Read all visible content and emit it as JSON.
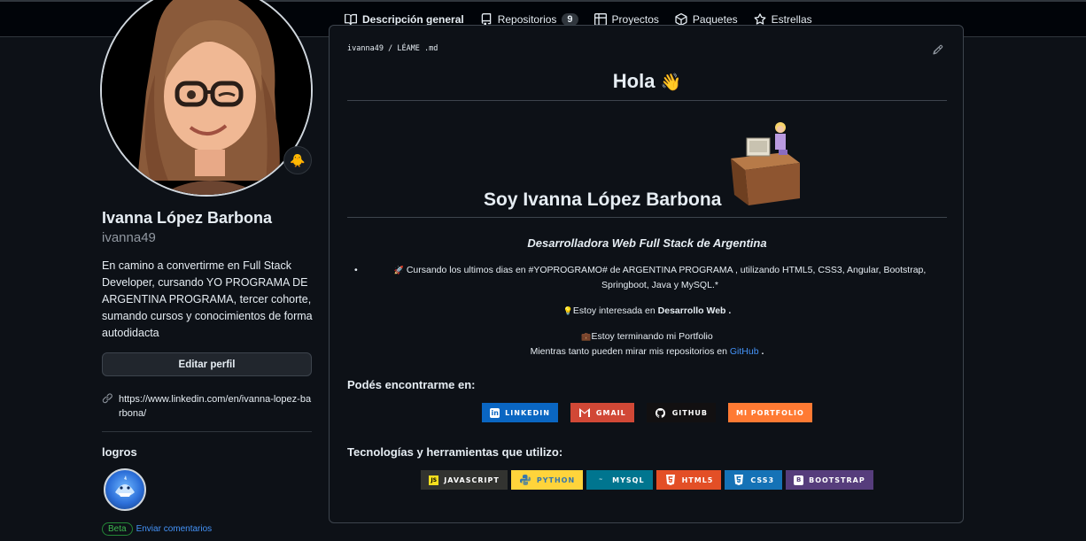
{
  "tabs": [
    {
      "label": "Descripción general",
      "icon": "book-icon",
      "active": true
    },
    {
      "label": "Repositorios",
      "icon": "repo-icon",
      "count": "9"
    },
    {
      "label": "Proyectos",
      "icon": "table-icon"
    },
    {
      "label": "Paquetes",
      "icon": "package-icon"
    },
    {
      "label": "Estrellas",
      "icon": "star-icon"
    }
  ],
  "profile": {
    "name": "Ivanna López Barbona",
    "login": "ivanna49",
    "bio": "En camino a convertirme en Full Stack Developer, cursando YO PROGRAMA DE ARGENTINA PROGRAMA, tercer cohorte, sumando cursos y conocimientos de forma autodidacta",
    "edit_label": "Editar perfil",
    "link": "https://www.linkedin.com/en/ivanna-lopez-barbona/",
    "status_emoji": "🐥",
    "achievements_title": "logros",
    "beta_label": "Beta",
    "feedback_label": "Enviar comentarios"
  },
  "readme": {
    "path_user": "ivanna49",
    "path_sep": "/",
    "path_file": "LÉAME .md",
    "title": "Hola",
    "wave": "👋",
    "heading": "Soy Ivanna López Barbona",
    "subtitle": "Desarrolladora Web Full Stack de Argentina",
    "bullet_emoji": "🚀",
    "bullet_text": "Cursando los ultimos dias en #YOPROGRAMO# de ARGENTINA PROGRAMA , utilizando HTML5, CSS3, Angular, Bootstrap, Springboot, Java y MySQL.*",
    "interest_emoji": "💡",
    "interest_prefix": "Estoy interesada en",
    "interest_bold": "Desarrollo Web",
    "interest_suffix": ".",
    "portfolio_emoji": "💼",
    "portfolio_text": "Estoy terminando mi Portfolio",
    "repos_prefix": "Mientras tanto pueden mirar mis repositorios en",
    "repos_link": "GitHub",
    "repos_suffix": ".",
    "find_title": "Podés encontrarme en:",
    "tech_title": "Tecnologías y herramientas que utilizo:"
  },
  "contact_badges": [
    {
      "label": "LINKEDIN",
      "color": "#0a66c2",
      "icon": "linkedin-icon"
    },
    {
      "label": "GMAIL",
      "color": "#d14836",
      "icon": "gmail-icon"
    },
    {
      "label": "GITHUB",
      "color": "#121011",
      "icon": "github-icon"
    },
    {
      "label": "MI PORTFOLIO",
      "color": "#ff7a33",
      "icon": ""
    }
  ],
  "tech_badges": [
    {
      "label": "JAVASCRIPT",
      "color": "#323330",
      "text_color": "#ffffff",
      "icon": "js-icon"
    },
    {
      "label": "PYTHON",
      "color": "#ffd43b",
      "text_color": "#3776ab",
      "icon": "python-icon"
    },
    {
      "label": "MYSQL",
      "color": "#00758f",
      "text_color": "#ffffff",
      "icon": "mysql-icon"
    },
    {
      "label": "HTML5",
      "color": "#e34f26",
      "text_color": "#ffffff",
      "icon": "html5-icon"
    },
    {
      "label": "CSS3",
      "color": "#1572b6",
      "text_color": "#ffffff",
      "icon": "css3-icon"
    },
    {
      "label": "BOOTSTRAP",
      "color": "#563d7c",
      "text_color": "#ffffff",
      "icon": "bootstrap-icon"
    }
  ]
}
